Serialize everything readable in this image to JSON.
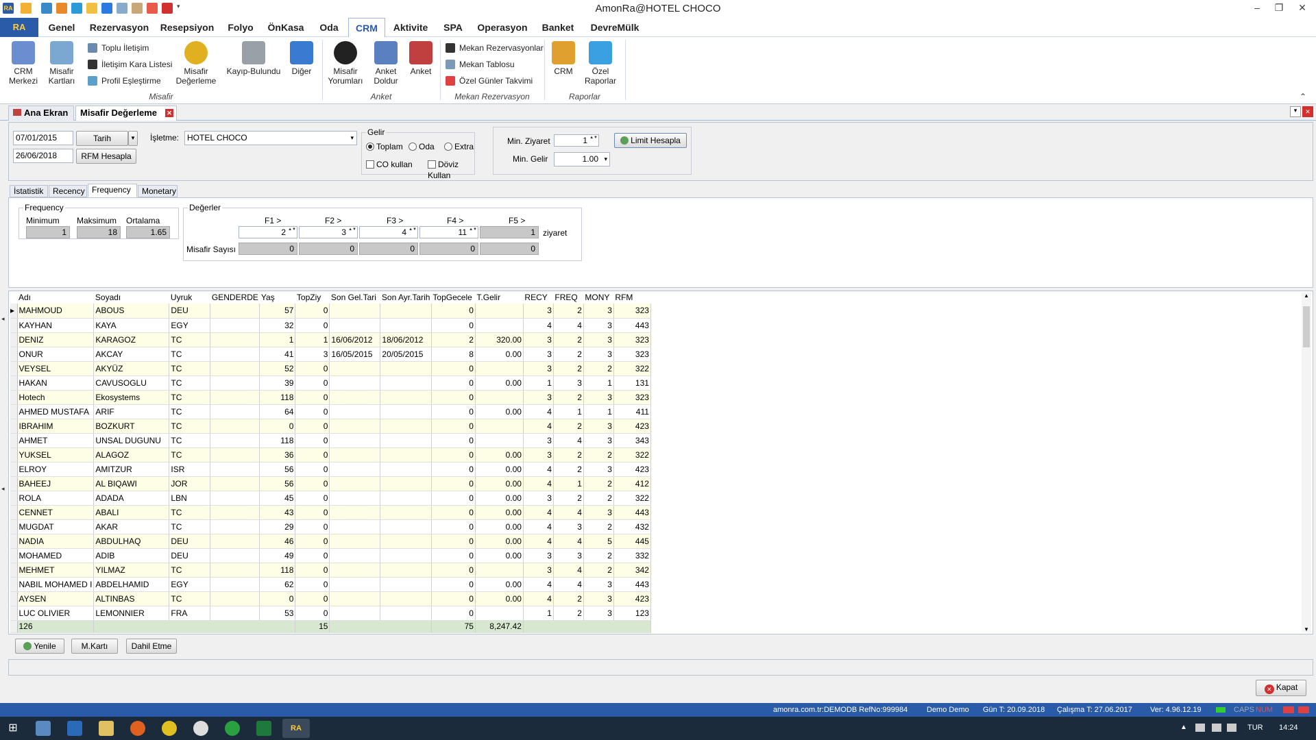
{
  "window": {
    "title": "AmonRa@HOTEL CHOCO",
    "app_logo": "RA"
  },
  "menu": [
    "Genel",
    "Rezervasyon",
    "Resepsiyon",
    "Folyo",
    "ÖnKasa",
    "Oda",
    "CRM",
    "Aktivite",
    "SPA",
    "Operasyon",
    "Banket",
    "DevreMülk"
  ],
  "menu_active": "CRM",
  "ribbon": {
    "crm_merkezi": "CRM\nMerkezi",
    "misafir_kartlari": "Misafir\nKartları",
    "toplu_iletisim": "Toplu İletişim",
    "iletisim_kara_listesi": "İletişim Kara Listesi",
    "profil_eslestirme": "Profil Eşleştirme",
    "misafir_degerleme": "Misafir\nDeğerleme",
    "kayip_bulundu": "Kayıp-Bulundu",
    "diger": "Diğer",
    "misafir_yorumlari": "Misafir\nYorumları",
    "anket_doldur": "Anket\nDoldur",
    "anket": "Anket",
    "mekan_rezervasyonlari": "Mekan Rezervasyonları",
    "mekan_tablosu": "Mekan Tablosu",
    "ozel_gunler_takvimi": "Özel Günler Takvimi",
    "crm": "CRM",
    "ozel_raporlar": "Özel\nRaporlar",
    "group_misafir": "Misafir",
    "group_anket": "Anket",
    "group_mekan": "Mekan Rezervasyon",
    "group_raporlar": "Raporlar"
  },
  "doc_tabs": {
    "home": "Ana Ekran",
    "active": "Misafir Değerleme"
  },
  "filters": {
    "date_from": "07/01/2015",
    "date_to": "26/06/2018",
    "date_type": "Tarih",
    "rfm_button": "RFM Hesapla",
    "isletme_label": "İşletme:",
    "isletme_value": "HOTEL CHOCO",
    "gelir_label": "Gelir",
    "gelir_options": [
      "Toplam",
      "Oda",
      "Extra"
    ],
    "gelir_selected": "Toplam",
    "co_kullan": "CO kullan",
    "doviz_kullan": "Döviz Kullan",
    "min_ziyaret_label": "Min. Ziyaret",
    "min_ziyaret_value": "1",
    "min_gelir_label": "Min. Gelir",
    "min_gelir_value": "1.00",
    "limit_button": "Limit Hesapla"
  },
  "sub_tabs": [
    "İstatistik",
    "Recency",
    "Frequency",
    "Monetary"
  ],
  "sub_tab_active": "Frequency",
  "frequency": {
    "title": "Frequency",
    "min_label": "Minimum",
    "max_label": "Maksimum",
    "avg_label": "Ortalama",
    "min": "1",
    "max": "18",
    "avg": "1.65",
    "degerler_label": "Değerler",
    "f_labels": [
      "F1 >",
      "F2 >",
      "F3 >",
      "F4 >",
      "F5 >"
    ],
    "f_values": [
      "2",
      "3",
      "4",
      "11",
      "1"
    ],
    "ziyaret": "ziyaret",
    "misafir_sayisi_label": "Misafir Sayısı",
    "misafir_sayisi": [
      "0",
      "0",
      "0",
      "0",
      "0"
    ]
  },
  "grid": {
    "columns": [
      "Adı",
      "Soyadı",
      "Uyruk",
      "GENDERDE",
      "Yaş",
      "TopZiy",
      "Son Gel.Tari",
      "Son Ayr.Tarih",
      "TopGecele",
      "T.Gelir",
      "RECY",
      "FREQ",
      "MONY",
      "RFM"
    ],
    "rows": [
      [
        "MAHMOUD",
        "ABOUS",
        "DEU",
        "",
        "57",
        "0",
        "",
        "",
        "0",
        "",
        "3",
        "2",
        "3",
        "323"
      ],
      [
        "KAYHAN",
        "KAYA",
        "EGY",
        "",
        "32",
        "0",
        "",
        "",
        "0",
        "",
        "4",
        "4",
        "3",
        "443"
      ],
      [
        "DENIZ",
        "KARAGOZ",
        "TC",
        "",
        "1",
        "1",
        "16/06/2012",
        "18/06/2012",
        "2",
        "320.00",
        "3",
        "2",
        "3",
        "323"
      ],
      [
        "ONUR",
        "AKCAY",
        "TC",
        "",
        "41",
        "3",
        "16/05/2015",
        "20/05/2015",
        "8",
        "0.00",
        "3",
        "2",
        "3",
        "323"
      ],
      [
        "VEYSEL",
        "AKYÜZ",
        "TC",
        "",
        "52",
        "0",
        "",
        "",
        "0",
        "",
        "3",
        "2",
        "2",
        "322"
      ],
      [
        "HAKAN",
        "CAVUSOGLU",
        "TC",
        "",
        "39",
        "0",
        "",
        "",
        "0",
        "0.00",
        "1",
        "3",
        "1",
        "131"
      ],
      [
        "Hotech",
        "Ekosystems",
        "TC",
        "",
        "118",
        "0",
        "",
        "",
        "0",
        "",
        "3",
        "2",
        "3",
        "323"
      ],
      [
        "AHMED MUSTAFA",
        "ARIF",
        "TC",
        "",
        "64",
        "0",
        "",
        "",
        "0",
        "0.00",
        "4",
        "1",
        "1",
        "411"
      ],
      [
        "IBRAHIM",
        "BOZKURT",
        "TC",
        "",
        "0",
        "0",
        "",
        "",
        "0",
        "",
        "4",
        "2",
        "3",
        "423"
      ],
      [
        "AHMET",
        " UNSAL DUGUNU",
        "TC",
        "",
        "118",
        "0",
        "",
        "",
        "0",
        "",
        "3",
        "4",
        "3",
        "343"
      ],
      [
        "YUKSEL",
        "ALAGOZ",
        "TC",
        "",
        "36",
        "0",
        "",
        "",
        "0",
        "0.00",
        "3",
        "2",
        "2",
        "322"
      ],
      [
        "ELROY",
        "AMITZUR",
        "ISR",
        "",
        "56",
        "0",
        "",
        "",
        "0",
        "0.00",
        "4",
        "2",
        "3",
        "423"
      ],
      [
        "BAHEEJ",
        "AL BIQAWI",
        "JOR",
        "",
        "56",
        "0",
        "",
        "",
        "0",
        "0.00",
        "4",
        "1",
        "2",
        "412"
      ],
      [
        "ROLA",
        "ADADA",
        "LBN",
        "",
        "45",
        "0",
        "",
        "",
        "0",
        "0.00",
        "3",
        "2",
        "2",
        "322"
      ],
      [
        "CENNET",
        "ABALI",
        "TC",
        "",
        "43",
        "0",
        "",
        "",
        "0",
        "0.00",
        "4",
        "4",
        "3",
        "443"
      ],
      [
        "MUGDAT",
        "AKAR",
        "TC",
        "",
        "29",
        "0",
        "",
        "",
        "0",
        "0.00",
        "4",
        "3",
        "2",
        "432"
      ],
      [
        "NADIA",
        "ABDULHAQ",
        "DEU",
        "",
        "46",
        "0",
        "",
        "",
        "0",
        "0.00",
        "4",
        "4",
        "5",
        "445"
      ],
      [
        "MOHAMED",
        "ADIB",
        "DEU",
        "",
        "49",
        "0",
        "",
        "",
        "0",
        "0.00",
        "3",
        "3",
        "2",
        "332"
      ],
      [
        "MEHMET",
        "YILMAZ",
        "TC",
        "",
        "118",
        "0",
        "",
        "",
        "0",
        "",
        "3",
        "4",
        "2",
        "342"
      ],
      [
        "NABIL MOHAMED I",
        "ABDELHAMID",
        "EGY",
        "",
        "62",
        "0",
        "",
        "",
        "0",
        "0.00",
        "4",
        "4",
        "3",
        "443"
      ],
      [
        "AYSEN",
        "ALTINBAS",
        "TC",
        "",
        "0",
        "0",
        "",
        "",
        "0",
        "0.00",
        "4",
        "2",
        "3",
        "423"
      ],
      [
        "LUC OLIVIER",
        "LEMONNIER",
        "FRA",
        "",
        "53",
        "0",
        "",
        "",
        "0",
        "",
        "1",
        "2",
        "3",
        "123"
      ]
    ],
    "footer": {
      "count": "126",
      "topziy": "15",
      "topgecele": "75",
      "tgelir": "8,247.42"
    }
  },
  "bottom_buttons": {
    "yenile": "Yenile",
    "mkarti": "M.Kartı",
    "dahil_etme": "Dahil Etme",
    "kapat": "Kapat"
  },
  "status": {
    "db": "amonra.com.tr:DEMODB RefNo:999984",
    "user": "Demo Demo",
    "gun": "Gün T: 20.09.2018",
    "calisma": "Çalışma T: 27.06.2017",
    "ver": "Ver: 4.96.12.19",
    "caps": "CAPS",
    "num": "NUM"
  },
  "taskbar": {
    "lang": "TUR",
    "time": "14:24",
    "app": "RA"
  },
  "colors": {
    "accent": "#2a5ba8",
    "row_alt": "#fefde6",
    "footer": "#d8e8d0"
  }
}
